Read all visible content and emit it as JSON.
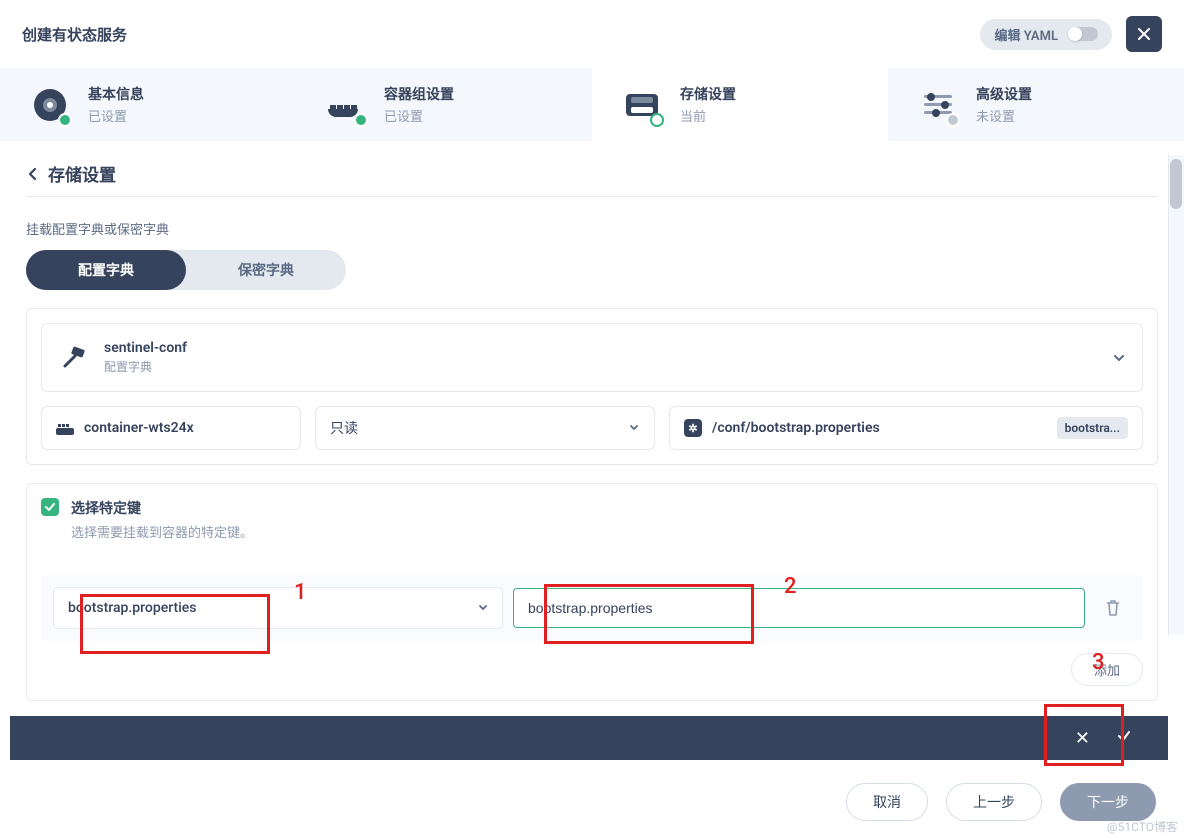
{
  "header": {
    "title": "创建有状态服务",
    "editYaml": "编辑 YAML"
  },
  "steps": [
    {
      "title": "基本信息",
      "sub": "已设置"
    },
    {
      "title": "容器组设置",
      "sub": "已设置"
    },
    {
      "title": "存储设置",
      "sub": "当前"
    },
    {
      "title": "高级设置",
      "sub": "未设置"
    }
  ],
  "panel": {
    "title": "存储设置",
    "mountDesc": "挂载配置字典或保密字典",
    "pillConfig": "配置字典",
    "pillSecret": "保密字典"
  },
  "configItem": {
    "name": "sentinel-conf",
    "type": "配置字典",
    "container": "container-wts24x",
    "mode": "只读",
    "path": "/conf/bootstrap.properties",
    "chip": "bootstra..."
  },
  "keys": {
    "title": "选择特定键",
    "desc": "选择需要挂载到容器的特定键。",
    "selectVal": "bootstrap.properties",
    "inputVal": "bootstrap.properties",
    "addLabel": "添加"
  },
  "footer": {
    "cancel": "取消",
    "prev": "上一步",
    "next": "下一步"
  },
  "watermark": "@51CTO博客",
  "annotations": {
    "n1": "1",
    "n2": "2",
    "n3": "3"
  }
}
